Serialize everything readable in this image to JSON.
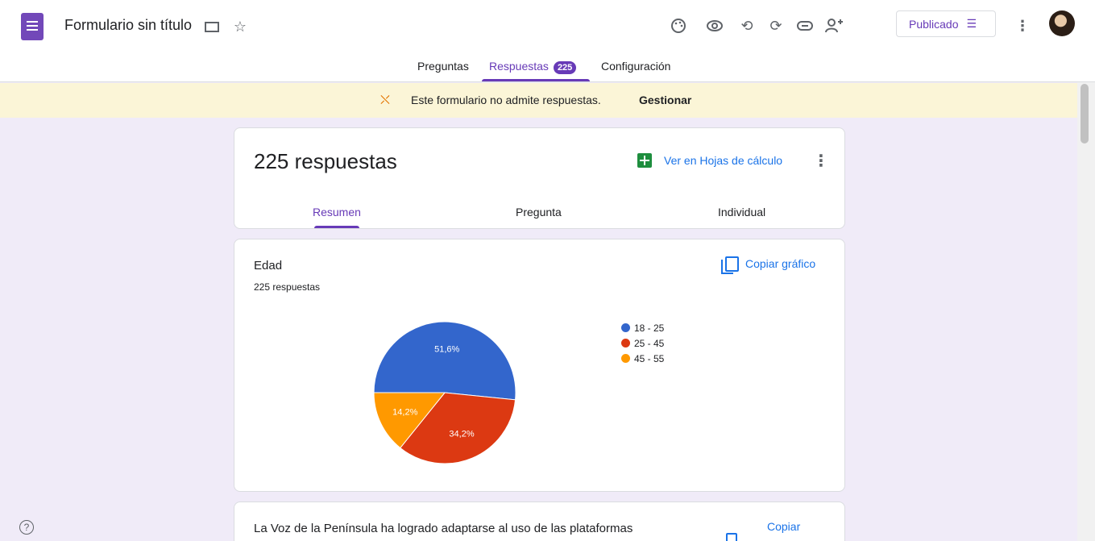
{
  "header": {
    "doc_title": "Formulario sin título",
    "publish_label": "Publicado"
  },
  "tabs": [
    {
      "label": "Preguntas"
    },
    {
      "label": "Respuestas",
      "badge": "225"
    },
    {
      "label": "Configuración"
    }
  ],
  "banner": {
    "text": "Este formulario no admite respuestas.",
    "action": "Gestionar"
  },
  "summary": {
    "count_text": "225 respuestas",
    "sheets_label": "Ver en Hojas de cálculo",
    "subtabs": [
      "Resumen",
      "Pregunta",
      "Individual"
    ]
  },
  "question1": {
    "title": "Edad",
    "count": "225 respuestas",
    "copy_label": "Copiar gráfico"
  },
  "question2": {
    "title": "La Voz de la Península ha logrado adaptarse al uso de las plataformas",
    "copy_label": "Copiar"
  },
  "colors": {
    "accent": "#673ab7",
    "link": "#1a73e8",
    "banner": "#fbf5d7",
    "background": "#f0ebf8"
  },
  "icons": {
    "toolbar": [
      "palette-icon",
      "eye-icon",
      "undo-icon",
      "redo-icon",
      "link-icon",
      "add-collaborator-icon",
      "more-icon"
    ]
  },
  "chart_data": {
    "type": "pie",
    "categories": [
      "18 - 25",
      "25 - 45",
      "45 - 55"
    ],
    "values": [
      51.6,
      34.2,
      14.2
    ],
    "labels": [
      "51,6%",
      "34,2%",
      "14,2%"
    ],
    "colors": [
      "#3366cc",
      "#dc3912",
      "#ff9900"
    ],
    "legend_position": "right"
  }
}
